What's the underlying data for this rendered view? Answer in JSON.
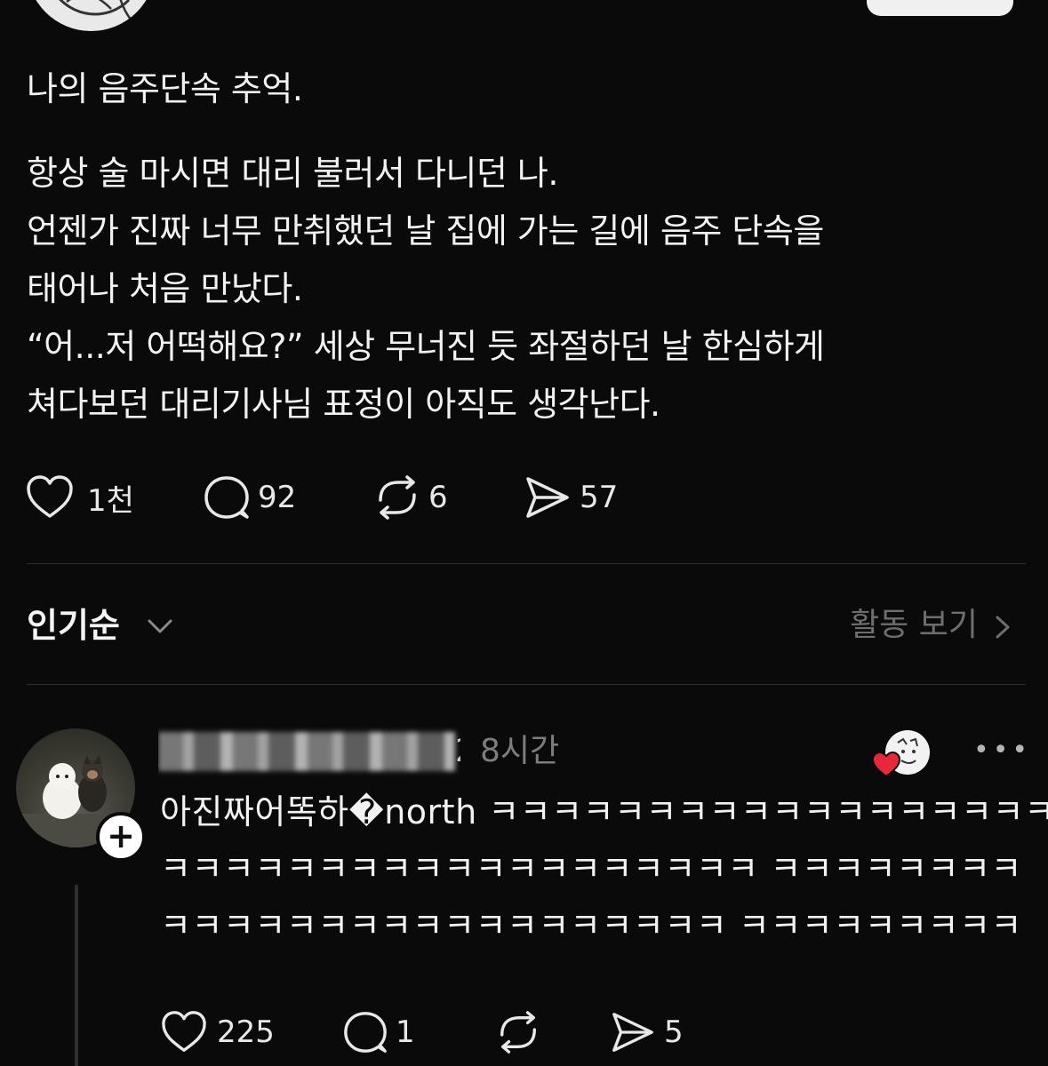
{
  "post": {
    "lines": [
      "나의 음주단속 추억.",
      "항상 술 마시면 대리 불러서 다니던 나.",
      "언젠가 진짜 너무 만취했던 날 집에 가는 길에 음주 단속을",
      "태어나 처음 만났다.",
      "“어...저 어떡해요?” 세상 무너진 듯 좌절하던 날 한심하게",
      "쳐다보던 대리기사님 표정이 아직도 생각난다."
    ],
    "stats": {
      "likes": "1천",
      "comments": "92",
      "reposts": "6",
      "shares": "57"
    }
  },
  "sort": {
    "label": "인기순",
    "activity_link": "활동 보기"
  },
  "reply": {
    "username_visible_tail": "2",
    "timestamp": "8시간",
    "lines": [
      "아진짜어똑하�north ㅋㅋㅋㅋㅋㅋㅋㅋㅋㅋㅋㅋㅋㅋㅋㅋㅋㅋㅋ",
      "ㅋㅋㅋㅋㅋㅋㅋㅋㅋㅋㅋㅋㅋㅋㅋㅋㅋㅋㅋ ㅋㅋㅋㅋㅋㅋㅋㅋ",
      "ㅋㅋㅋㅋㅋㅋㅋㅋㅋㅋㅋㅋㅋㅋㅋㅋㅋㅋ ㅋㅋㅋㅋㅋㅋㅋㅋㅋ"
    ],
    "stats": {
      "likes": "225",
      "comments": "1",
      "shares": "5"
    }
  },
  "icons": {
    "like": "heart-icon",
    "comment": "comment-bubble-icon",
    "repost": "repost-icon",
    "share": "send-icon",
    "more": "more-dots-icon",
    "follow": "plus-icon"
  },
  "colors": {
    "background": "#0a0a0a",
    "text": "#f2f2f2",
    "muted": "#7d7d7d",
    "reaction_heart": "#e8273a"
  }
}
